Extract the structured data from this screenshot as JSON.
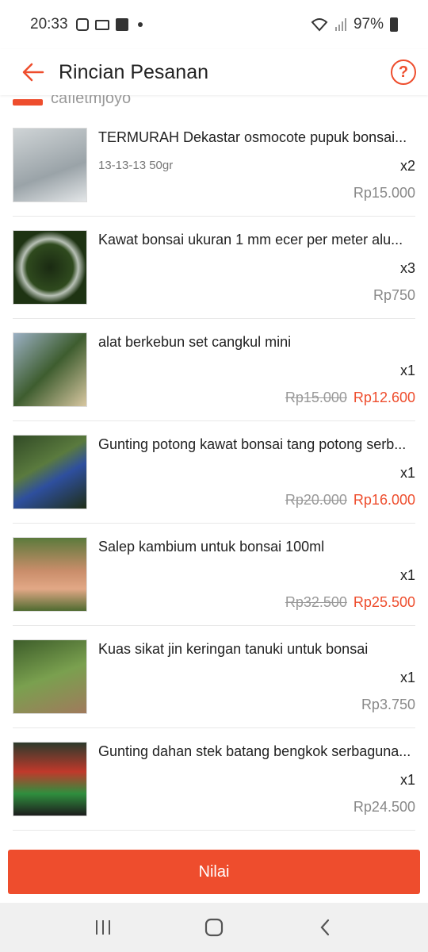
{
  "status_bar": {
    "time": "20:33",
    "battery": "97%"
  },
  "app_bar": {
    "title": "Rincian Pesanan"
  },
  "shop": {
    "name": "caflet​​mjoyo"
  },
  "items": [
    {
      "name": "TERMURAH Dekastar osmocote pupuk bonsai...",
      "variant": "13-13-13 50gr",
      "qty": "x2",
      "price": "Rp15.000",
      "old_price": "",
      "image": "fertilizer-pack"
    },
    {
      "name": "Kawat bonsai ukuran 1 mm ecer per meter alu...",
      "variant": "",
      "qty": "x3",
      "price": "Rp750",
      "old_price": "",
      "image": "wire-coil"
    },
    {
      "name": "alat berkebun set cangkul mini",
      "variant": "",
      "qty": "x1",
      "price": "Rp12.600",
      "old_price": "Rp15.000",
      "image": "garden-tools"
    },
    {
      "name": "Gunting potong kawat bonsai tang potong serb...",
      "variant": "",
      "qty": "x1",
      "price": "Rp16.000",
      "old_price": "Rp20.000",
      "image": "wire-cutter"
    },
    {
      "name": "Salep kambium untuk bonsai 100ml",
      "variant": "",
      "qty": "x1",
      "price": "Rp25.500",
      "old_price": "Rp32.500",
      "image": "cambium-bottle"
    },
    {
      "name": "Kuas sikat  jin keringan tanuki untuk bonsai",
      "variant": "",
      "qty": "x1",
      "price": "Rp3.750",
      "old_price": "",
      "image": "brush"
    },
    {
      "name": "Gunting dahan stek batang bengkok serbaguna...",
      "variant": "",
      "qty": "x1",
      "price": "Rp24.500",
      "old_price": "",
      "image": "pruning-shears"
    }
  ],
  "action": {
    "rate_label": "Nilai"
  },
  "colors": {
    "accent": "#ee4d2d",
    "text": "#222222",
    "muted": "#888888"
  }
}
